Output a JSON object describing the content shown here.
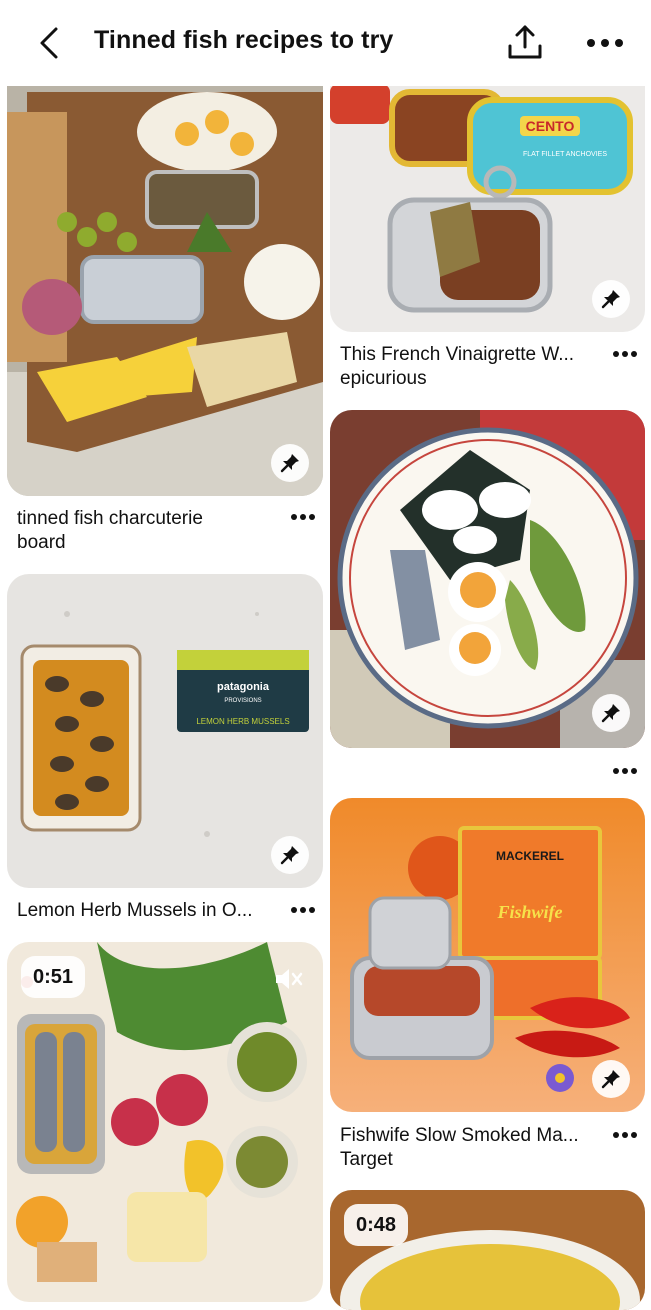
{
  "header": {
    "title": "Tinned fish recipes to try",
    "back_icon": "chevron-left-icon",
    "share_icon": "share-upload-icon",
    "more_icon": "more-horizontal-icon"
  },
  "pins": [
    {
      "id": "charcuterie",
      "caption_lines": [
        "tinned fish charcuterie",
        "board"
      ]
    },
    {
      "id": "mussels",
      "caption_lines": [
        "Lemon Herb Mussels in O..."
      ],
      "product_text": [
        "patagonia",
        "PROVISIONS",
        "LEMON HERB MUSSELS"
      ]
    },
    {
      "id": "sardine-board",
      "video_time": "0:51",
      "mute_icon": "mute-icon"
    },
    {
      "id": "anchovies",
      "caption_lines": [
        "This French Vinaigrette W...",
        "epicurious"
      ],
      "product_text": [
        "CENTO",
        "FLAT FILLET ANCHOVIES"
      ]
    },
    {
      "id": "sardine-plate",
      "caption_lines": []
    },
    {
      "id": "mackerel",
      "caption_lines": [
        "Fishwife Slow Smoked Ma...",
        "Target"
      ],
      "product_text": [
        "MACKEREL",
        "Fishwife"
      ]
    },
    {
      "id": "soup",
      "video_time": "0:48"
    }
  ],
  "colors": {
    "background": "#ffffff",
    "text": "#111111",
    "pin_button_bg": "#ffffff"
  }
}
